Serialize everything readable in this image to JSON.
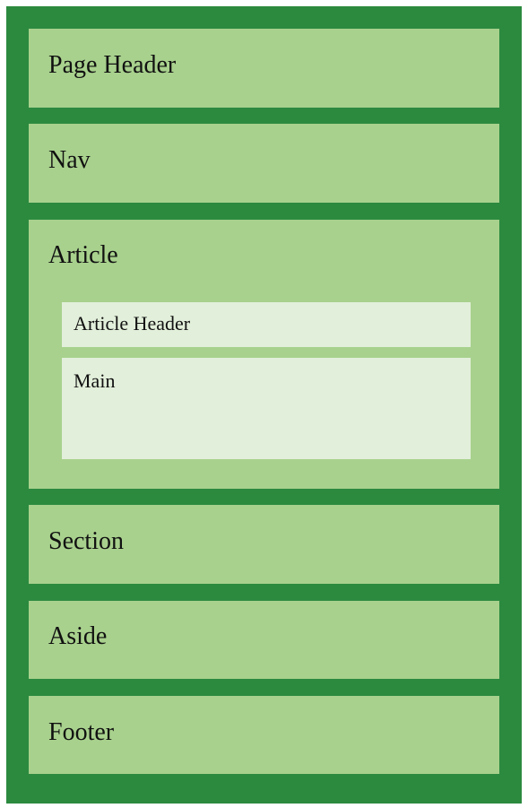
{
  "colors": {
    "frame": "#2c8a3f",
    "block": "#a8d18d",
    "inner": "#e2efda"
  },
  "blocks": {
    "page_header": "Page Header",
    "nav": "Nav",
    "article": "Article",
    "article_header": "Article Header",
    "main": "Main",
    "section": "Section",
    "aside": "Aside",
    "footer": "Footer"
  }
}
